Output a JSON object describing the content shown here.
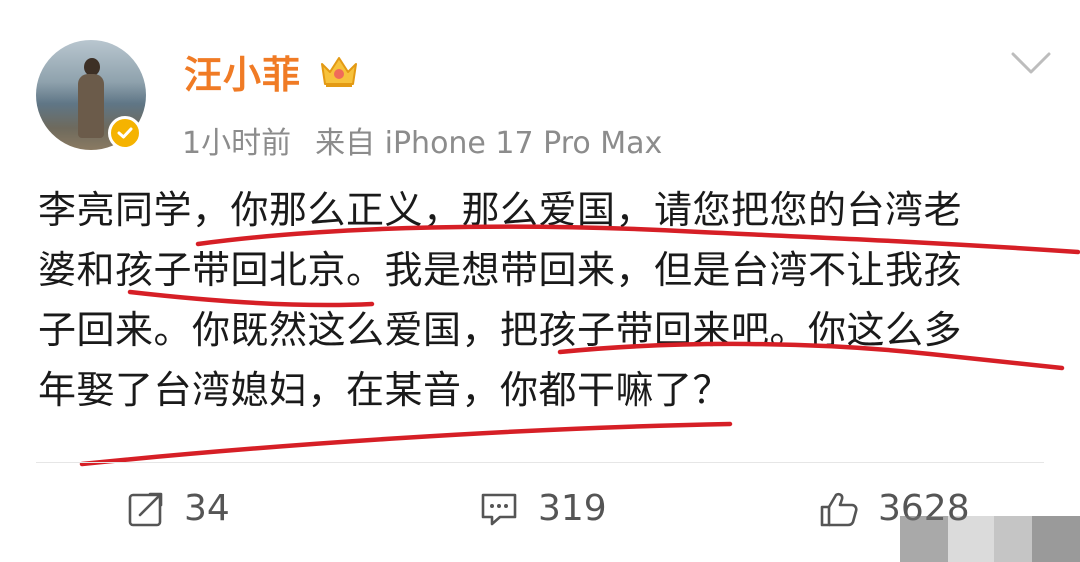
{
  "user": {
    "name": "汪小菲",
    "time": "1小时前",
    "source": "来自 iPhone 17 Pro Max"
  },
  "content": {
    "lines": [
      "李亮同学，你那么正义，那么爱国，请您把您的台湾老",
      "婆和孩子带回北京。我是想带回来，但是台湾不让我孩",
      "子回来。你既然这么爱国，把孩子带回来吧。你这么多",
      "年娶了台湾媳妇，在某音，你都干嘛了？"
    ]
  },
  "actions": {
    "repost_count": "34",
    "comment_count": "319",
    "like_count": "3628"
  },
  "icons": {
    "verified": "verified-badge-icon",
    "vip": "crown-vip-icon",
    "menu": "chevron-down-icon",
    "repost": "repost-icon",
    "comment": "comment-icon",
    "like": "thumbs-up-icon"
  },
  "colors": {
    "username": "#f07b25",
    "underline": "#d61f26",
    "verified": "#f5b300"
  }
}
